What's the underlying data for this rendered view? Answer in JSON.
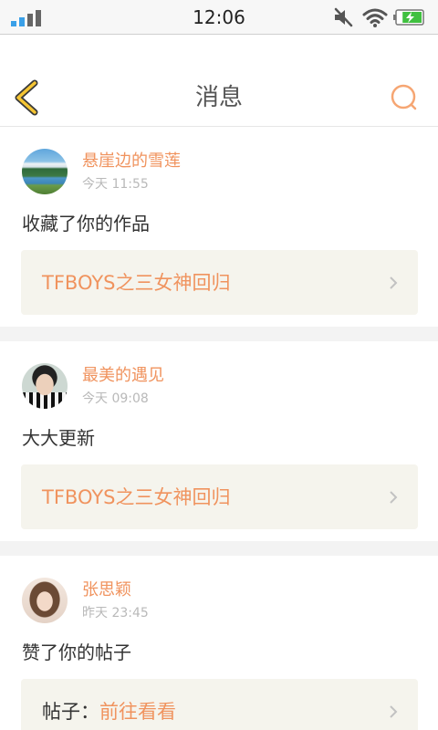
{
  "status_bar": {
    "time": "12:06",
    "signal": {
      "active": 2,
      "total": 4
    },
    "battery": {
      "level": 0.8,
      "charging": true
    },
    "icons": [
      "signal-icon",
      "mute-icon",
      "wifi-icon",
      "battery-icon"
    ]
  },
  "header": {
    "title": "消息",
    "back_icon": "back-arrow-icon",
    "search_icon": "search-icon"
  },
  "messages": [
    {
      "user": "悬崖边的雪莲",
      "time": "今天 11:55",
      "action": "收藏了你的作品",
      "target": {
        "label": "TFBOYS之三女神回归"
      }
    },
    {
      "user": "最美的遇见",
      "time": "今天 09:08",
      "action": "大大更新",
      "target": {
        "label": "TFBOYS之三女神回归"
      }
    },
    {
      "user": "张思颖",
      "time": "昨天 23:45",
      "action": "赞了你的帖子",
      "target": {
        "prefix": "帖子：",
        "label": "前往看看"
      }
    }
  ],
  "colors": {
    "accent": "#f0935e",
    "text": "#333333",
    "muted": "#b9b9b9",
    "title": "#555555",
    "box_bg": "#f5f4ed",
    "separator": "#f3f3f3",
    "back_icon": "#f5c533",
    "search_icon": "#f6a673",
    "signal_active": "#3aa0e8",
    "signal_inactive": "#666666",
    "battery": "#40c040"
  }
}
